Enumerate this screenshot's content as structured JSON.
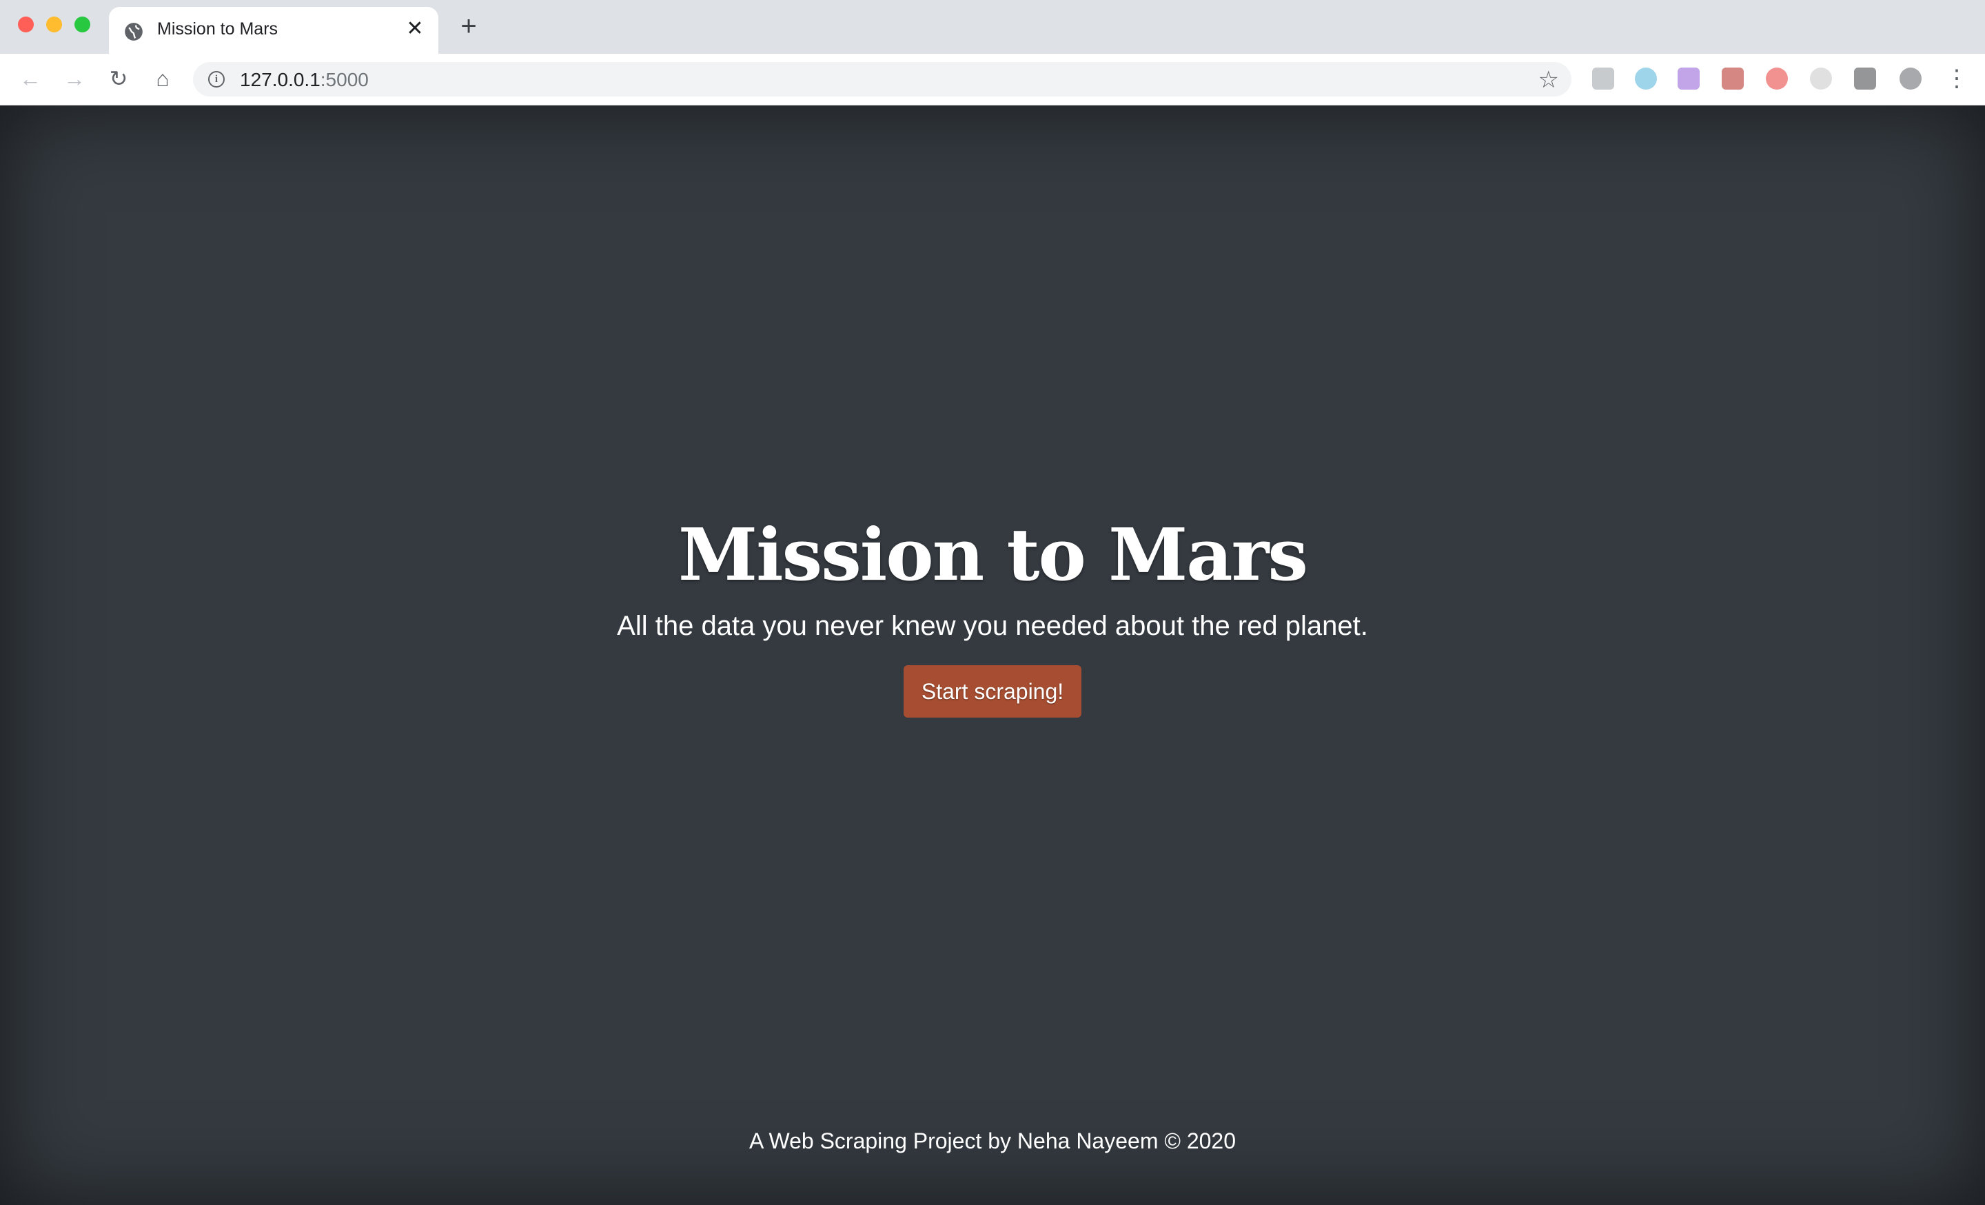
{
  "browser": {
    "tab_title": "Mission to Mars",
    "url_host": "127.0.0.1",
    "url_port": ":5000",
    "icons": [
      "globe-icon",
      "close-icon",
      "plus-icon",
      "back-arrow-icon",
      "forward-arrow-icon",
      "reload-icon",
      "home-icon",
      "info-icon",
      "star-icon",
      "menu-icon"
    ],
    "traffic_light_colors": [
      "#ff5f57",
      "#febc2e",
      "#28c840"
    ]
  },
  "page": {
    "title": "Mission to Mars",
    "subtitle": "All the data you never knew you needed about the red planet.",
    "button_label": "Start scraping!",
    "footer": "A Web Scraping Project by Neha Nayeem © 2020",
    "colors": {
      "background": "#343a40",
      "button": "#a74e32",
      "text": "#ffffff"
    }
  }
}
